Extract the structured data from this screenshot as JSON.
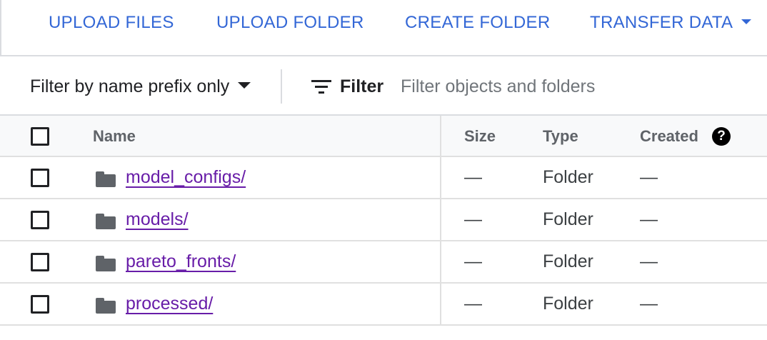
{
  "toolbar": {
    "upload_files": "UPLOAD FILES",
    "upload_folder": "UPLOAD FOLDER",
    "create_folder": "CREATE FOLDER",
    "transfer_data": "TRANSFER DATA"
  },
  "filter_bar": {
    "prefix_mode": "Filter by name prefix only",
    "filter_label": "Filter",
    "filter_placeholder": "Filter objects and folders",
    "filter_value": ""
  },
  "table": {
    "columns": {
      "name": "Name",
      "size": "Size",
      "type": "Type",
      "created": "Created"
    },
    "help_icon_glyph": "?",
    "rows": [
      {
        "name": "model_configs/",
        "size": "—",
        "type": "Folder",
        "created": "—",
        "checked": false
      },
      {
        "name": "models/",
        "size": "—",
        "type": "Folder",
        "created": "—",
        "checked": false
      },
      {
        "name": "pareto_fronts/",
        "size": "—",
        "type": "Folder",
        "created": "—",
        "checked": false
      },
      {
        "name": "processed/",
        "size": "—",
        "type": "Folder",
        "created": "—",
        "checked": false
      }
    ]
  },
  "colors": {
    "accent_blue": "#3367d6",
    "link_purple": "#681da8",
    "icon_gray": "#5f6368",
    "border": "#dadce0"
  },
  "icons": {
    "transfer_caret": "caret-down-icon",
    "prefix_caret": "caret-down-icon",
    "filter": "filter-list-icon",
    "help": "help-circle-icon",
    "folder": "folder-icon"
  }
}
